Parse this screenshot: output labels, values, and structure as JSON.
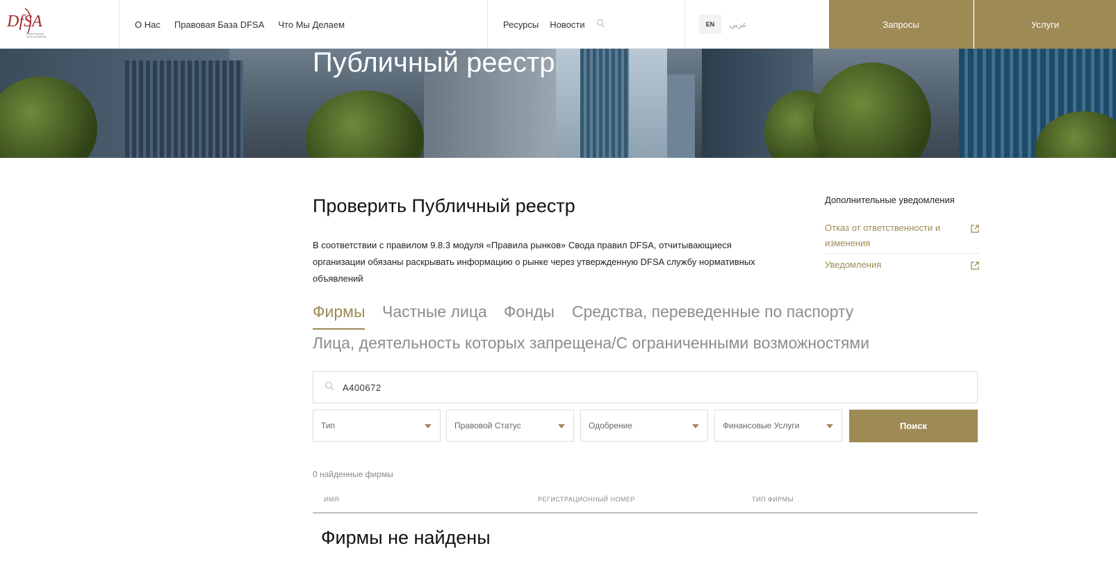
{
  "header": {
    "logo_text": "DFSA",
    "logo_subtitle": "Dubai Financial Services Authority",
    "nav_left": [
      "О Нас",
      "Правовая База DFSA",
      "Что Мы Делаем"
    ],
    "nav_right": [
      "Ресурсы",
      "Новости"
    ],
    "lang_en": "EN",
    "lang_ar": "عربي",
    "requests": "Запросы",
    "services": "Услуги"
  },
  "hero": {
    "title": "Публичный реестр"
  },
  "main": {
    "section_title": "Проверить Публичный реестр",
    "intro": "В соответствии с правилом 9.8.3 модуля «Правила рынков» Свода правил DFSA, отчитывающиеся организации обязаны раскрывать информацию о рынке через утвержденную DFSA службу нормативных объявлений",
    "tabs": [
      "Фирмы",
      "Частные лица",
      "Фонды",
      "Средства, переведенные по паспорту",
      "Лица, деятельность которых запрещена/С ограниченными возможностями"
    ],
    "search_value": "A400672",
    "filters": [
      "Тип",
      "Правовой Статус",
      "Одобрение",
      "Финансовые Услуги"
    ],
    "search_button": "Поиск",
    "found_text": "0 найденные фирмы",
    "columns": [
      "ИМЯ",
      "РЕГИСТРАЦИОННЫЙ НОМЕР",
      "ТИП ФИРМЫ"
    ],
    "empty_text": "Фирмы не найдены"
  },
  "aside": {
    "title": "Дополнительные уведомления",
    "links": [
      "Отказ от ответственности и изменения",
      "Уведомления"
    ]
  },
  "colors": {
    "accent": "#9d8a55",
    "brand_red": "#a3272f"
  }
}
